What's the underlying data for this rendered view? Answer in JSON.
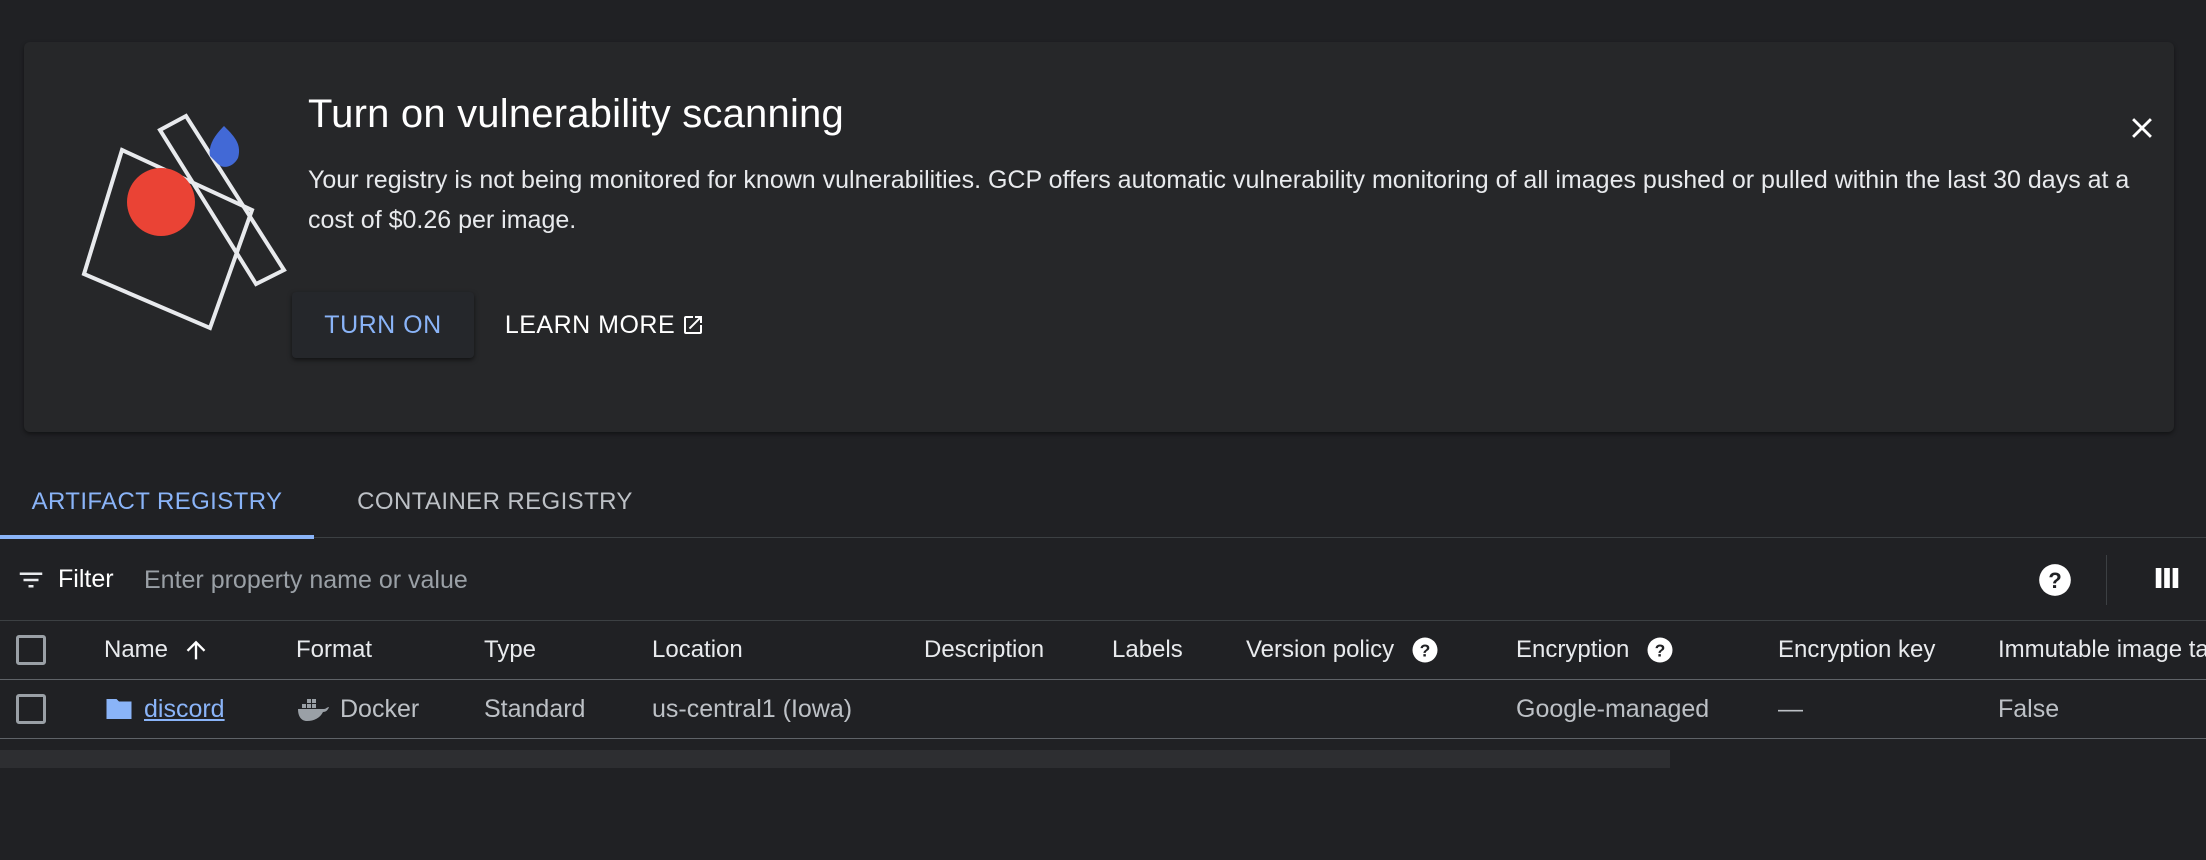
{
  "banner": {
    "title": "Turn on vulnerability scanning",
    "body": "Your registry is not being monitored for known vulnerabilities. GCP offers automatic vulnerability monitoring of all images pushed or pulled within the last 30 days at a cost of $0.26 per image.",
    "turn_on_label": "TURN ON",
    "learn_more_label": "LEARN MORE",
    "icons": {
      "illustration": "vulnerability-illustration",
      "external_link": "open-in-new-icon",
      "close": "close-icon"
    }
  },
  "tabs": [
    {
      "label": "ARTIFACT REGISTRY",
      "active": true
    },
    {
      "label": "CONTAINER REGISTRY",
      "active": false
    }
  ],
  "filter": {
    "label": "Filter",
    "placeholder": "Enter property name or value",
    "value": ""
  },
  "table": {
    "columns": [
      "Name",
      "Format",
      "Type",
      "Location",
      "Description",
      "Labels",
      "Version policy",
      "Encryption",
      "Encryption key",
      "Immutable image ta"
    ],
    "sort": {
      "column": "Name",
      "direction": "ascending"
    },
    "rows": [
      {
        "name": "discord",
        "format": "Docker",
        "type": "Standard",
        "location": "us-central1 (Iowa)",
        "description": "",
        "labels": "",
        "version_policy": "",
        "encryption": "Google-managed",
        "encryption_key": "—",
        "immutable": "False"
      }
    ]
  },
  "colors": {
    "background": "#202124",
    "accent": "#8ab4f8",
    "illustration_red": "#ea4335",
    "illustration_blue": "#4269d6"
  }
}
